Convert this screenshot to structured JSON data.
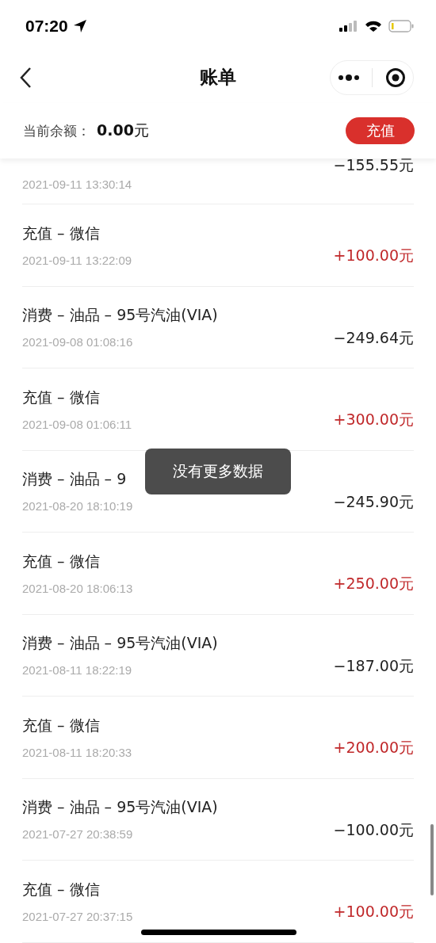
{
  "status_bar": {
    "time": "07:20"
  },
  "nav": {
    "title": "账单"
  },
  "balance": {
    "label": "当前余额：",
    "amount": "0.00",
    "unit": "元",
    "button": "充值"
  },
  "transactions": [
    {
      "kind": "spend",
      "date": "2021-09-11 13:30:14",
      "amount": "−155.55元"
    },
    {
      "kind": "recharge",
      "title": "充值 – 微信",
      "date": "2021-09-11 13:22:09",
      "amount": "+100.00元"
    },
    {
      "kind": "spend",
      "title": "消费 – 油品 – 95号汽油(VIA)",
      "date": "2021-09-08 01:08:16",
      "amount": "−249.64元"
    },
    {
      "kind": "recharge",
      "title": "充值 – 微信",
      "date": "2021-09-08 01:06:11",
      "amount": "+300.00元"
    },
    {
      "kind": "spend",
      "title": "消费 – 油品 – 9",
      "date": "2021-08-20 18:10:19",
      "amount": "−245.90元"
    },
    {
      "kind": "recharge",
      "title": "充值 – 微信",
      "date": "2021-08-20 18:06:13",
      "amount": "+250.00元"
    },
    {
      "kind": "spend",
      "title": "消费 – 油品 – 95号汽油(VIA)",
      "date": "2021-08-11 18:22:19",
      "amount": "−187.00元"
    },
    {
      "kind": "recharge",
      "title": "充值 – 微信",
      "date": "2021-08-11 18:20:33",
      "amount": "+200.00元"
    },
    {
      "kind": "spend",
      "title": "消费 – 油品 – 95号汽油(VIA)",
      "date": "2021-07-27 20:38:59",
      "amount": "−100.00元"
    },
    {
      "kind": "recharge",
      "title": "充值 – 微信",
      "date": "2021-07-27 20:37:15",
      "amount": "+100.00元"
    }
  ],
  "toast": {
    "text": "没有更多数据"
  }
}
